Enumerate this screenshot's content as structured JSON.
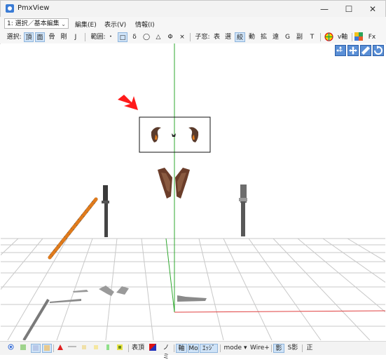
{
  "window": {
    "title": "PmxView",
    "minimize_glyph": "—",
    "maximize_glyph": "☐",
    "close_glyph": "✕"
  },
  "row1": {
    "mode_select": "1: 選択／基本編集",
    "menus": [
      "編集(E)",
      "表示(V)",
      "情報(I)"
    ]
  },
  "row2": {
    "select_label": "選択:",
    "select_items": [
      "頂",
      "面",
      "骨",
      "剛",
      "J"
    ],
    "range_label": "範囲:",
    "range_items": [
      "・",
      "□",
      "δ",
      "◯",
      "△",
      "Φ",
      "×"
    ],
    "child_label": "子窓:",
    "child_items": [
      "表",
      "選",
      "絞",
      "動",
      "拡",
      "遠",
      "G",
      "副",
      "T"
    ],
    "vaxis_label": "v軸",
    "fx_label": "Fx"
  },
  "bottom": {
    "items_a": [
      "表頂",
      "ノミ"
    ],
    "items_b": [
      "軸",
      "Mo",
      "ｴｯｼﾞ"
    ],
    "mode_label": "mode",
    "wire_label": "Wire+",
    "shadow_label": "影",
    "sshadow_label": "S影",
    "seikaku_label": "正"
  },
  "colors": {
    "accent_select": "#cfe3f7",
    "grid": "#c8c8c8",
    "y_axis": "#2fa82f",
    "x_axis": "#e04040",
    "arrow": "#ff1a1a",
    "stick_orange": "#e07b1c"
  },
  "icons": {
    "app": "pmxview-icon",
    "view_controls": [
      "move-view-icon",
      "pan-view-icon",
      "zoom-view-icon",
      "rotate-view-icon"
    ]
  }
}
